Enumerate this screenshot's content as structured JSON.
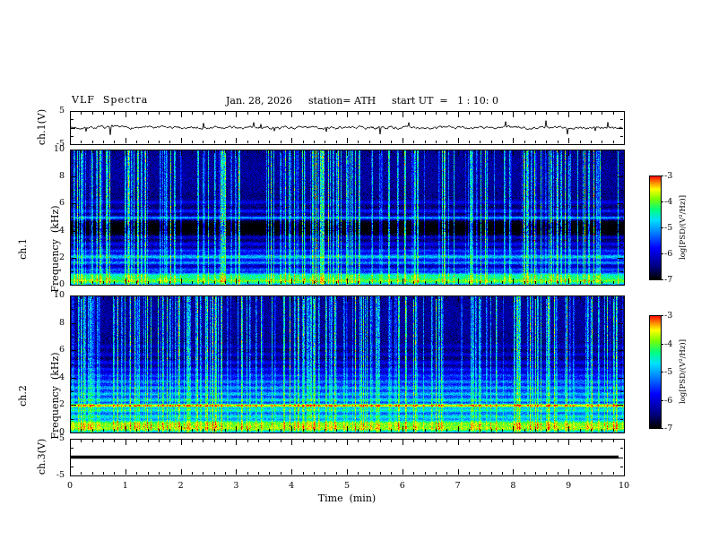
{
  "header": {
    "title": "VLF  Spectra",
    "date": "Jan. 28, 2026",
    "station": "station= ATH",
    "start_ut": "start UT  =   1 : 10: 0"
  },
  "axes": {
    "x": {
      "label": "Time  (min)",
      "ticks": [
        "0",
        "1",
        "2",
        "3",
        "4",
        "5",
        "6",
        "7",
        "8",
        "9",
        "10"
      ],
      "range": [
        0,
        10
      ]
    },
    "wave_yticks": [
      "5",
      "-5"
    ],
    "spec_yticks": [
      "10",
      "8",
      "6",
      "4",
      "2",
      "0"
    ]
  },
  "panels": {
    "ch1wave": {
      "label": "ch.1(V)"
    },
    "ch1spec": {
      "label_line1": "ch.1",
      "label_line2": "Frequency  (kHz)"
    },
    "ch2spec": {
      "label_line1": "ch.2",
      "label_line2": "Frequency  (kHz)"
    },
    "ch3wave": {
      "label": "ch.3(V)"
    }
  },
  "colorbar": {
    "label": "log[PSD/(V²/Hz)]",
    "ticks": [
      "-3",
      "-4",
      "-5",
      "-6",
      "-7"
    ],
    "range": [
      -7,
      -3
    ],
    "stops": [
      [
        0.0,
        "#000000"
      ],
      [
        0.12,
        "#000080"
      ],
      [
        0.3,
        "#0000ff"
      ],
      [
        0.45,
        "#0080ff"
      ],
      [
        0.57,
        "#00e0ff"
      ],
      [
        0.67,
        "#00ff80"
      ],
      [
        0.78,
        "#80ff00"
      ],
      [
        0.87,
        "#ffff00"
      ],
      [
        0.94,
        "#ff8000"
      ],
      [
        1.0,
        "#ff0000"
      ]
    ]
  },
  "chart_data": [
    {
      "id": "ch1_waveform",
      "type": "line",
      "ylabel": "ch.1(V)",
      "xlim": [
        0,
        10
      ],
      "ylim": [
        -5,
        5
      ],
      "baseline_v": 0,
      "noise_v": 0.8,
      "smoothing": 0.55,
      "spike_prob": 0.04,
      "spike_v": 2.2,
      "description": "noisy channel-1 voltage trace fluctuating about 0 V"
    },
    {
      "id": "ch1_spectrogram",
      "type": "heatmap",
      "xlim": [
        0,
        10
      ],
      "ylim": [
        0,
        10
      ],
      "zlim": [
        -7,
        -3
      ],
      "background_level": -6.65,
      "noise": 0.3,
      "streak_density": 0.28,
      "streak_strength": 2.1,
      "bands": [
        {
          "f": 0.25,
          "w": 0.25,
          "level": 2.6
        },
        {
          "f": 0.7,
          "w": 0.15,
          "level": 1.6
        },
        {
          "f": 1.1,
          "w": 0.12,
          "level": 1.2
        },
        {
          "f": 1.6,
          "w": 0.12,
          "level": 1.5
        },
        {
          "f": 2.05,
          "w": 0.15,
          "level": 1.8
        },
        {
          "f": 2.5,
          "w": 0.12,
          "level": 1.1
        },
        {
          "f": 3.0,
          "w": 0.12,
          "level": 0.8
        },
        {
          "f": 3.5,
          "w": 0.1,
          "level": 0.7
        },
        {
          "f": 4.2,
          "w": 0.45,
          "level": -0.6
        },
        {
          "f": 4.95,
          "w": 0.1,
          "level": 1.7
        },
        {
          "f": 5.45,
          "w": 0.1,
          "level": 0.9
        },
        {
          "f": 6.1,
          "w": 0.1,
          "level": 0.6
        },
        {
          "f": 8.3,
          "w": 1.8,
          "level": 0.3
        }
      ],
      "description": "ch.1 VLF spectrogram: blue background, dense bright vertical sferic streaks, horizontal emission lines below ~6 kHz, dark band near 4 kHz"
    },
    {
      "id": "ch2_spectrogram",
      "type": "heatmap",
      "xlim": [
        0,
        10
      ],
      "ylim": [
        0,
        10
      ],
      "zlim": [
        -7,
        -3
      ],
      "background_level": -6.65,
      "noise": 0.3,
      "streak_density": 0.28,
      "streak_strength": 2.1,
      "bands": [
        {
          "f": 0.25,
          "w": 0.25,
          "level": 2.7
        },
        {
          "f": 0.7,
          "w": 0.18,
          "level": 2.0
        },
        {
          "f": 1.15,
          "w": 0.15,
          "level": 1.9
        },
        {
          "f": 1.6,
          "w": 0.15,
          "level": 2.1
        },
        {
          "f": 1.95,
          "w": 0.1,
          "level": 3.1
        },
        {
          "f": 2.35,
          "w": 0.15,
          "level": 1.9
        },
        {
          "f": 2.8,
          "w": 0.15,
          "level": 1.7
        },
        {
          "f": 3.25,
          "w": 0.15,
          "level": 1.6
        },
        {
          "f": 3.7,
          "w": 0.15,
          "level": 1.4
        },
        {
          "f": 4.15,
          "w": 0.15,
          "level": 1.1
        },
        {
          "f": 4.6,
          "w": 0.12,
          "level": 0.9
        },
        {
          "f": 5.1,
          "w": 0.12,
          "level": 0.7
        },
        {
          "f": 5.7,
          "w": 0.1,
          "level": 0.5
        },
        {
          "f": 6.3,
          "w": 0.1,
          "level": 0.4
        },
        {
          "f": 8.3,
          "w": 1.8,
          "level": 0.3
        }
      ],
      "description": "ch.2 VLF spectrogram: strong green/yellow horizontal banding below ~5 kHz incl. red line near 2 kHz, streaky blue region above"
    },
    {
      "id": "ch3_waveform",
      "type": "line",
      "ylabel": "ch.3(V)",
      "xlim": [
        0,
        10
      ],
      "ylim": [
        -5,
        5
      ],
      "constant_v": 0,
      "description": "flat (dead) channel-3 trace at 0 V"
    }
  ]
}
